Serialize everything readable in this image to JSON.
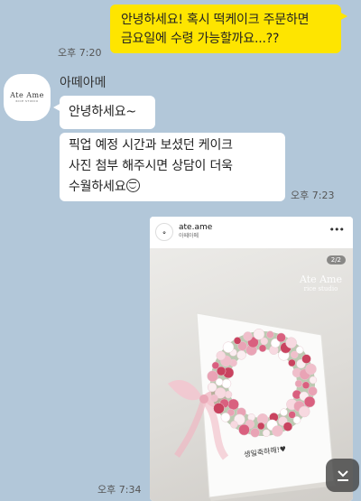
{
  "messages": {
    "outgoing_1": {
      "line1": "안녕하세요! 혹시 떡케이크 주문하면",
      "line2": "금요일에 수령 가능할까요...??",
      "time": "오후 7:20"
    },
    "sender": {
      "name": "아떼아메",
      "avatar_logo": "Ate Ame",
      "avatar_logo_sub": "RICE STUDIO"
    },
    "incoming_1": {
      "text": "안녕하세요~"
    },
    "incoming_2": {
      "line1": "픽업 예정 시간과 보셨던 케이크",
      "line2": "사진 첨부 해주시면 상담이 더욱",
      "line3": "수월하세요",
      "emoji": "smile-emoji",
      "time": "오후 7:23"
    },
    "shared_post": {
      "account": "ate.ame",
      "account_sub": "아떼아메",
      "more": "•••",
      "page_indicator": "2/2",
      "watermark_title": "Ate Ame",
      "watermark_sub": "rice studio",
      "cake_text": "생일축하해!♥",
      "time": "오후 7:34"
    }
  },
  "colors": {
    "background": "#b2c7d9",
    "my_bubble": "#fee500",
    "their_bubble": "#ffffff"
  },
  "icons": {
    "scroll_down": "chevron-down-icon"
  }
}
